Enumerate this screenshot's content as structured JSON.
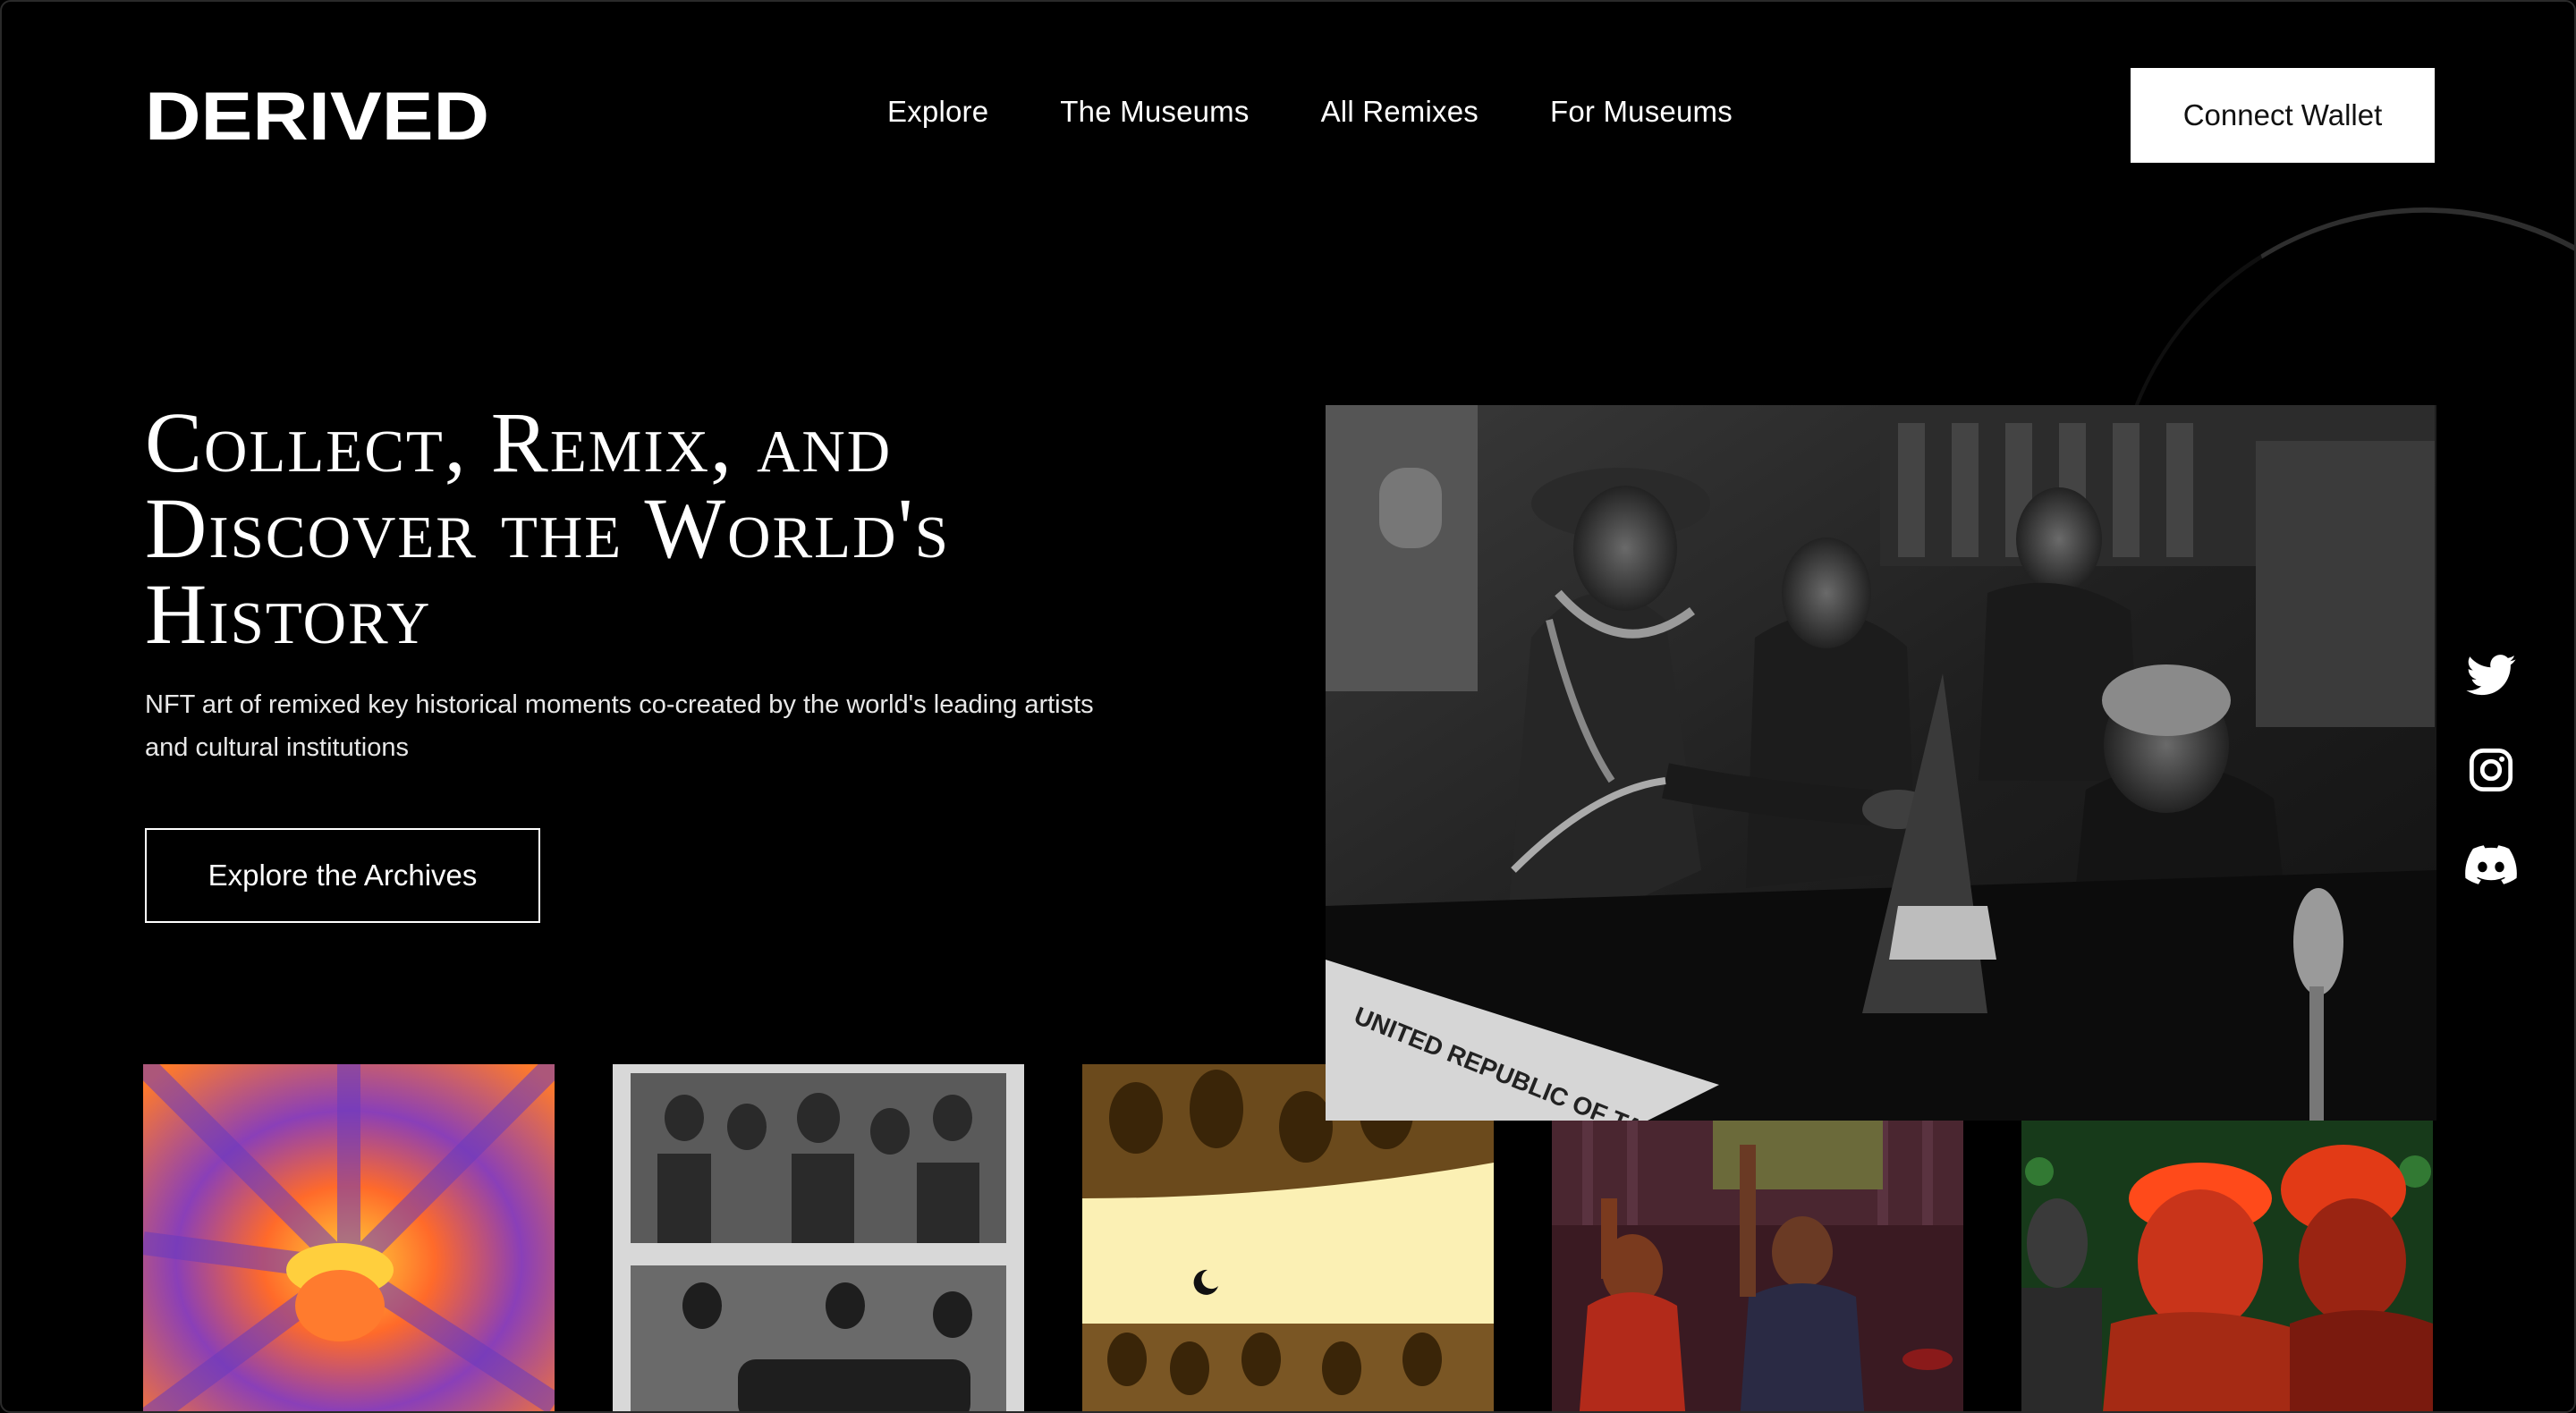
{
  "header": {
    "logo_text": "DERIVED",
    "nav": [
      "Explore",
      "The Museums",
      "All Remixes",
      "For Museums"
    ],
    "connect_wallet_label": "Connect Wallet"
  },
  "hero": {
    "title": "Collect, Remix, and Discover the World's History",
    "subtitle_line1": "NFT art of remixed key historical moments co-created by the world's leading artists",
    "subtitle_line2": "and cultural institutions",
    "cta_label": "Explore the Archives"
  },
  "hero_image": {
    "caption_text": "UNITED REPUBLIC OF TANZANIA"
  },
  "social": [
    "twitter-icon",
    "instagram-icon",
    "discord-icon"
  ],
  "gallery": [
    {
      "name": "psychedelic-crown-remix"
    },
    {
      "name": "newspaper-collage-remix"
    },
    {
      "name": "sepia-crowd-remix"
    },
    {
      "name": "raised-fists-remix"
    },
    {
      "name": "red-chiefs-remix"
    }
  ],
  "colors": {
    "background": "#000000",
    "text": "#ffffff",
    "wallet_button_bg": "#ffffff",
    "wallet_button_text": "#111111"
  }
}
